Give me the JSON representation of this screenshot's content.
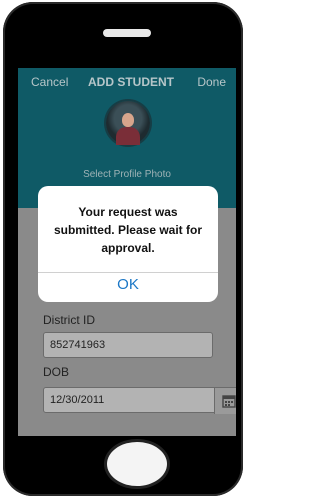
{
  "nav": {
    "cancel": "Cancel",
    "title": "ADD STUDENT",
    "done": "Done"
  },
  "profile": {
    "select_photo": "Select Profile Photo"
  },
  "form": {
    "district_label": "District ID",
    "district_value": "852741963",
    "dob_label": "DOB",
    "dob_value": "12/30/2011"
  },
  "dialog": {
    "message": "Your request was submitted. Please wait for approval.",
    "ok": "OK"
  },
  "icons": {
    "calendar": "calendar-icon",
    "avatar": "student-avatar"
  },
  "colors": {
    "header": "#0f5a66",
    "accent": "#1b77c6"
  }
}
